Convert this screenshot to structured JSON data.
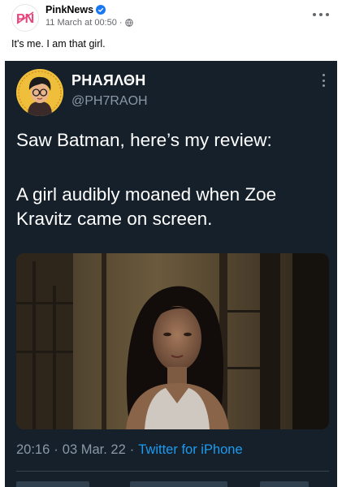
{
  "post": {
    "page_name": "PinkNews",
    "timestamp": "11 March at 00:50",
    "separator": "·",
    "caption": "It's me. I am that girl.",
    "avatar_logo": "PN"
  },
  "tweet": {
    "display_name": "PHAЯΛΘH",
    "handle": "@PH7RAOH",
    "text_line_1": "Saw Batman, here’s my review:",
    "text_line_2": "A girl audibly moaned when Zoe Kravitz came on screen.",
    "time": "20:16",
    "separator": "·",
    "date": "03 Mar. 22",
    "separator_2": "·",
    "source": "Twitter for iPhone"
  },
  "icons": {
    "verified": "verified-badge-icon",
    "privacy": "globe-icon",
    "more": "more-options-icon"
  },
  "colors": {
    "facebook_blue": "#1877f2",
    "tweet_background": "#15202b",
    "twitter_blue": "#1d9bf0",
    "muted_text": "#8b98a5",
    "avatar_yellow": "#efbe3a",
    "logo_pink": "#e8457c"
  }
}
